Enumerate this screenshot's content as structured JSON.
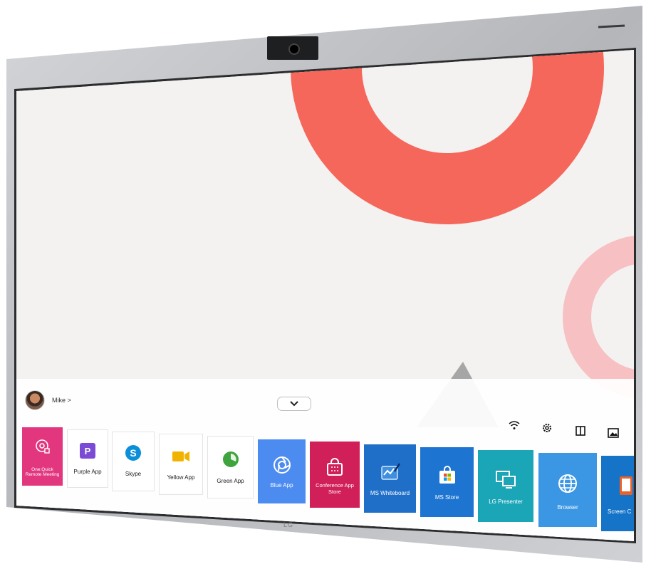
{
  "user": {
    "name": "Mike >"
  },
  "bezel_brand": "LG",
  "colors": {
    "wallpaper": "#f4f2f1",
    "accent_red": "#f5675b",
    "accent_pink": "#f7c1c3",
    "gray_triangle": "#a6a6a6",
    "bezel": "#bfc1c4"
  },
  "system_icons": [
    "wifi-icon",
    "settings-icon",
    "split-screen-icon",
    "picture-icon"
  ],
  "apps": [
    {
      "label": "One:Quick Remote Meeting",
      "icon": "remote-meeting-icon",
      "color": "#e2367f",
      "style": "dark"
    },
    {
      "label": "Purple App",
      "icon": "purple-app-icon",
      "color": "#7b4bd6",
      "style": "light"
    },
    {
      "label": "Skype",
      "icon": "skype-icon",
      "color": "#0a8fd8",
      "style": "light"
    },
    {
      "label": "Yellow App",
      "icon": "yellow-app-icon",
      "color": "#f2b300",
      "style": "light"
    },
    {
      "label": "Green App",
      "icon": "green-app-icon",
      "color": "#3fa33e",
      "style": "light"
    },
    {
      "label": "Blue App",
      "icon": "blue-app-icon",
      "color": "#4c8cf0",
      "style": "dark"
    },
    {
      "label": "Conference App Store",
      "icon": "store-bag-icon",
      "color": "#d11f5a",
      "style": "dark"
    },
    {
      "label": "MS Whiteboard",
      "icon": "whiteboard-icon",
      "color": "#1f6fc9",
      "style": "dark"
    },
    {
      "label": "MS Store",
      "icon": "ms-store-icon",
      "color": "#1e74d1",
      "style": "dark"
    },
    {
      "label": "LG Presenter",
      "icon": "presenter-icon",
      "color": "#1aa6b7",
      "style": "dark"
    },
    {
      "label": "Browser",
      "icon": "globe-icon",
      "color": "#3b97e3",
      "style": "dark"
    },
    {
      "label": "Screen C",
      "icon": "screen-share-icon",
      "color": "#1574c8",
      "style": "dark"
    }
  ]
}
